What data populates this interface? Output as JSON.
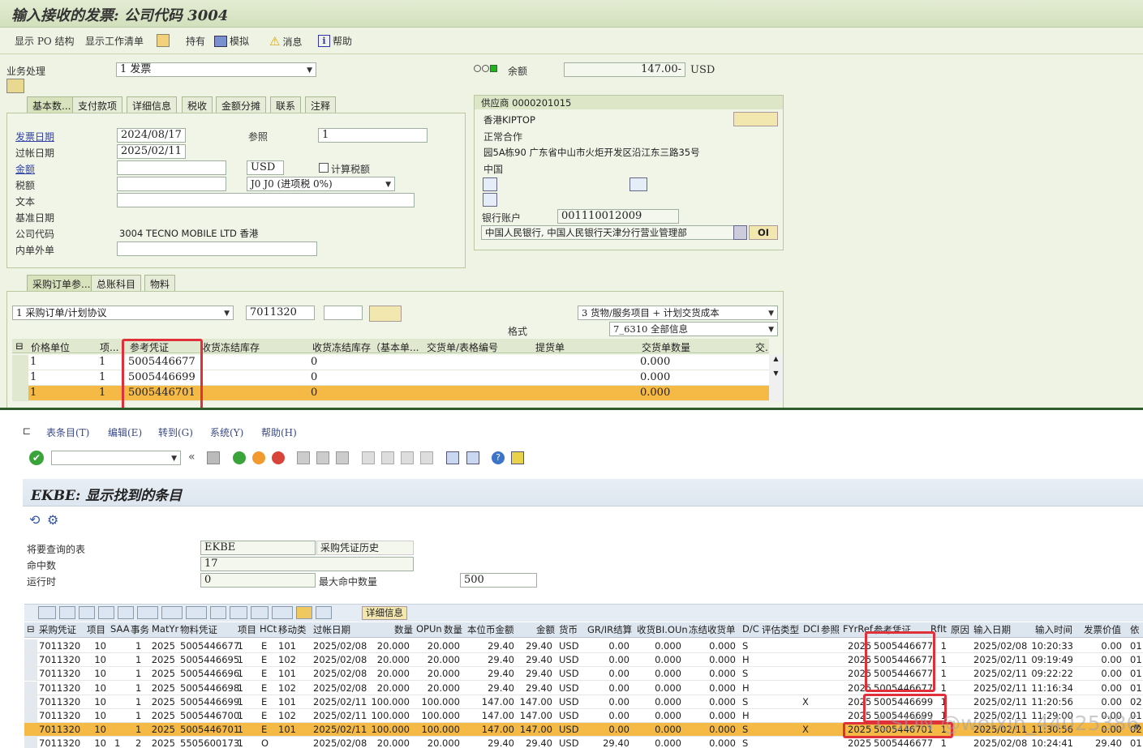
{
  "top": {
    "title": "输入接收的发票: 公司代码 3004",
    "toolbar": [
      "显示 PO 结构",
      "显示工作清单",
      "持有",
      "模拟",
      "消息",
      "帮助"
    ],
    "txn_label": "业务处理",
    "txn_value": "1 发票",
    "balance_label": "余额",
    "balance_value": "147.00-",
    "balance_currency": "USD",
    "tabs": [
      "基本数...",
      "支付款项",
      "详细信息",
      "税收",
      "金额分摊",
      "联系",
      "注释"
    ],
    "fields": {
      "invoice_date_label": "发票日期",
      "invoice_date": "2024/08/17",
      "reference_label": "参照",
      "reference": "1",
      "posting_date_label": "过帐日期",
      "posting_date": "2025/02/11",
      "amount_label": "金额",
      "amount": "",
      "currency": "USD",
      "calc_tax_label": "计算税额",
      "tax_label": "税额",
      "tax": "",
      "tax_code": "J0 J0 (进项税 0%)",
      "text_label": "文本",
      "baseline_label": "基准日期",
      "company_label": "公司代码",
      "company_value": "3004 TECNO MOBILE LTD 香港",
      "inout_label": "内单外单"
    },
    "vendor": {
      "header": "供应商 0000201015",
      "name": "香港KIPTOP",
      "type": "正常合作",
      "address": "园5A栋90 广东省中山市火炬开发区沿江东三路35号",
      "country": "中国",
      "bank_label": "银行账户",
      "bank_value": "001110012009",
      "bank_name": "中国人民银行, 中国人民银行天津分行营业管理部",
      "oi": "OI"
    },
    "po_tabs": [
      "采购订单参...",
      "总账科目",
      "物料"
    ],
    "po_type": "1 采购订单/计划协议",
    "po_number": "7011320",
    "po_layout": "3 货物/服务项目 + 计划交货成本",
    "format_label": "格式",
    "format_value": "7_6310 全部信息",
    "grid_headers": [
      "价格单位",
      "项...",
      "参考凭证",
      "收货冻结库存",
      "收货冻结库存（基本单...",
      "交货单/表格编号",
      "提货单",
      "交货单数量",
      "交."
    ],
    "grid_rows": [
      {
        "unit": "1",
        "item": "1",
        "ref": "5005446677",
        "blocked": "0",
        "qty": "0.000"
      },
      {
        "unit": "1",
        "item": "1",
        "ref": "5005446699",
        "blocked": "0",
        "qty": "0.000"
      },
      {
        "unit": "1",
        "item": "1",
        "ref": "5005446701",
        "blocked": "0",
        "qty": "0.000"
      }
    ]
  },
  "bottom": {
    "menu": [
      "表条目(T)",
      "编辑(E)",
      "转到(G)",
      "系统(Y)",
      "帮助(H)"
    ],
    "title": "EKBE:  显示找到的条目",
    "table_label": "将要查询的表",
    "table_value": "EKBE",
    "table_desc": "采购凭证历史",
    "hits_label": "命中数",
    "hits_value": "17",
    "runtime_label": "运行时",
    "runtime_value": "0",
    "maxhits_label": "最大命中数量",
    "maxhits_value": "500",
    "details_btn": "详细信息",
    "headers": [
      "采购凭证",
      "项目",
      "SAA",
      "事务",
      "MatYr",
      "物料凭证",
      "项目",
      "HCt",
      "移动类",
      "过帐日期",
      "数量",
      "OPUn",
      "数量",
      "本位币金额",
      "金额",
      "货币",
      "GR/IR结算",
      "收货BI.OUn",
      "冻结收货单",
      "D/C",
      "评估类型",
      "DCI",
      "参照",
      "FYrRef",
      "参考凭证",
      "RfIt",
      "原因",
      "输入日期",
      "输入时间",
      "发票价值",
      "依"
    ],
    "rows": [
      [
        "7011320",
        "10",
        "",
        "1",
        "2025",
        "5005446677",
        "1",
        "E",
        "101",
        "2025/02/08",
        "20.000",
        "20.000",
        "29.40",
        "29.40",
        "USD",
        "0.00",
        "0.000",
        "0.000",
        "S",
        "",
        "",
        "2025",
        "5005446677",
        "1",
        "2025/02/08",
        "10:20:33",
        "0.00",
        "01"
      ],
      [
        "7011320",
        "10",
        "",
        "1",
        "2025",
        "5005446695",
        "1",
        "E",
        "102",
        "2025/02/08",
        "20.000",
        "20.000",
        "29.40",
        "29.40",
        "USD",
        "0.00",
        "0.000",
        "0.000",
        "H",
        "",
        "",
        "2025",
        "5005446677",
        "1",
        "2025/02/11",
        "09:19:49",
        "0.00",
        "01"
      ],
      [
        "7011320",
        "10",
        "",
        "1",
        "2025",
        "5005446696",
        "1",
        "E",
        "101",
        "2025/02/08",
        "20.000",
        "20.000",
        "29.40",
        "29.40",
        "USD",
        "0.00",
        "0.000",
        "0.000",
        "S",
        "",
        "",
        "2025",
        "5005446677",
        "1",
        "2025/02/11",
        "09:22:22",
        "0.00",
        "01"
      ],
      [
        "7011320",
        "10",
        "",
        "1",
        "2025",
        "5005446698",
        "1",
        "E",
        "102",
        "2025/02/08",
        "20.000",
        "20.000",
        "29.40",
        "29.40",
        "USD",
        "0.00",
        "0.000",
        "0.000",
        "H",
        "",
        "",
        "2025",
        "5005446677",
        "1",
        "2025/02/11",
        "11:16:34",
        "0.00",
        "01"
      ],
      [
        "7011320",
        "10",
        "",
        "1",
        "2025",
        "5005446699",
        "1",
        "E",
        "101",
        "2025/02/11",
        "100.000",
        "100.000",
        "147.00",
        "147.00",
        "USD",
        "0.00",
        "0.000",
        "0.000",
        "S",
        "X",
        "",
        "2025",
        "5005446699",
        "1",
        "2025/02/11",
        "11:20:56",
        "0.00",
        "02"
      ],
      [
        "7011320",
        "10",
        "",
        "1",
        "2025",
        "5005446700",
        "1",
        "E",
        "102",
        "2025/02/11",
        "100.000",
        "100.000",
        "147.00",
        "147.00",
        "USD",
        "0.00",
        "0.000",
        "0.000",
        "H",
        "",
        "",
        "2025",
        "5005446699",
        "1",
        "2025/02/11",
        "11:29:00",
        "0.00",
        "01"
      ],
      [
        "7011320",
        "10",
        "",
        "1",
        "2025",
        "5005446701",
        "1",
        "E",
        "101",
        "2025/02/11",
        "100.000",
        "100.000",
        "147.00",
        "147.00",
        "USD",
        "0.00",
        "0.000",
        "0.000",
        "S",
        "X",
        "",
        "2025",
        "5005446701",
        "1",
        "2025/02/11",
        "11:30:56",
        "0.00",
        "02"
      ],
      [
        "7011320",
        "10",
        "1",
        "2",
        "2025",
        "5505600173",
        "1",
        "O",
        "",
        "2025/02/08",
        "20.000",
        "20.000",
        "29.40",
        "29.40",
        "USD",
        "29.40",
        "0.000",
        "0.000",
        "S",
        "",
        "",
        "2025",
        "5005446677",
        "1",
        "2025/02/08",
        "10:24:41",
        "29.40",
        "01"
      ]
    ],
    "watermark": "CSDN @weixin_44025386"
  },
  "colors": {
    "selected_row": "#f5b946",
    "highlight": "#e0303a",
    "sap_green": "#d2e0bd"
  }
}
